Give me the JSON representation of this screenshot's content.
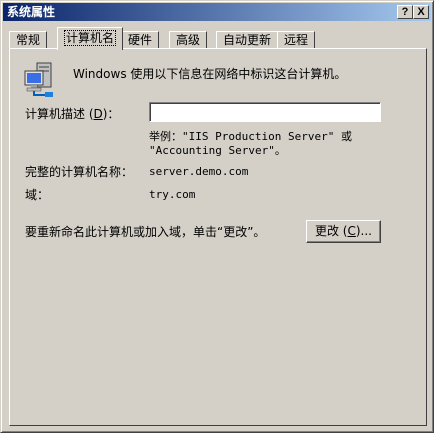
{
  "window": {
    "title": "系统属性",
    "help_button": "?",
    "close_button": "X"
  },
  "tabs": [
    {
      "label": "常规",
      "active": false
    },
    {
      "label": "计算机名",
      "active": true
    },
    {
      "label": "硬件",
      "active": false
    },
    {
      "label": "高级",
      "active": false
    },
    {
      "label": "自动更新",
      "active": false
    },
    {
      "label": "远程",
      "active": false
    }
  ],
  "computer_name_tab": {
    "intro_text": "Windows 使用以下信息在网络中标识这台计算机。",
    "description_label_prefix": "计算机描述 (",
    "description_label_hotkey": "D",
    "description_label_suffix": ")：",
    "description_value": "",
    "example_line1": "举例：\"IIS Production Server\" 或",
    "example_line2": "\"Accounting Server\"。",
    "full_name_label": "完整的计算机名称：",
    "full_name_value": "server.demo.com",
    "domain_label": "域：",
    "domain_value": "try.com",
    "rename_text": "要重新命名此计算机或加入域，单击“更改”。",
    "change_button_prefix": "更改 (",
    "change_button_hotkey": "C",
    "change_button_suffix": ")..."
  }
}
